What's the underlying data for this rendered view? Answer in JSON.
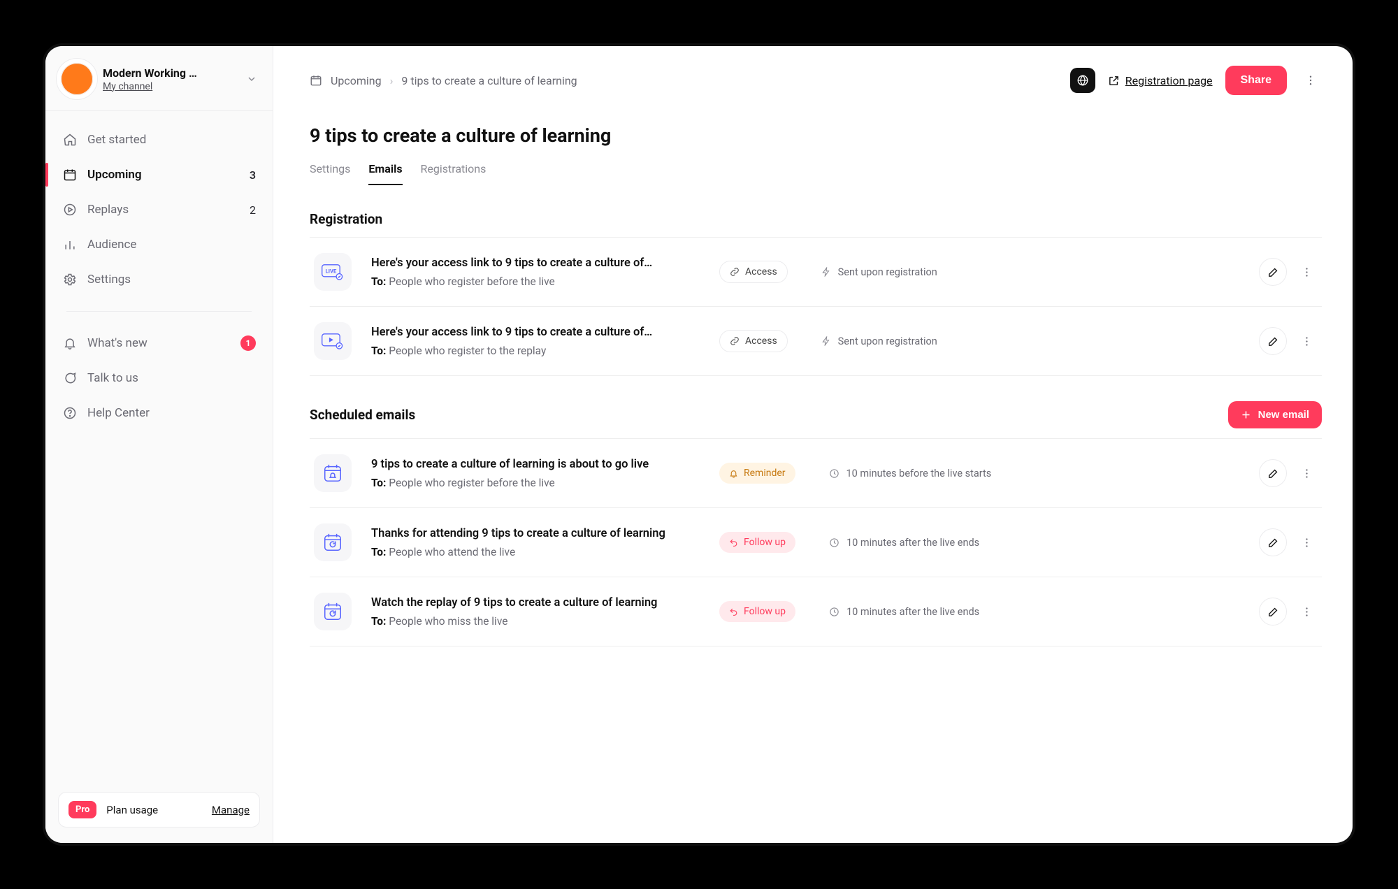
{
  "workspace": {
    "name": "Modern Working …",
    "sublabel": "My channel"
  },
  "nav": {
    "get_started": "Get started",
    "upcoming": "Upcoming",
    "upcoming_count": "3",
    "replays": "Replays",
    "replays_count": "2",
    "audience": "Audience",
    "settings": "Settings",
    "whats_new": "What's new",
    "whats_new_badge": "1",
    "talk": "Talk to us",
    "help": "Help Center"
  },
  "plan": {
    "chip": "Pro",
    "usage": "Plan usage",
    "manage": "Manage"
  },
  "breadcrumb": {
    "root": "Upcoming",
    "leaf": "9 tips to create a culture of learning"
  },
  "header": {
    "reg_link": "Registration page",
    "share": "Share"
  },
  "page": {
    "title": "9 tips to create a culture of learning"
  },
  "tabs": {
    "settings": "Settings",
    "emails": "Emails",
    "registrations": "Registrations"
  },
  "sections": {
    "registration": "Registration",
    "scheduled": "Scheduled emails",
    "new_email": "New email"
  },
  "labels": {
    "to": "To:",
    "access": "Access",
    "reminder": "Reminder",
    "followup": "Follow up",
    "sent_upon": "Sent upon registration"
  },
  "registration_rows": [
    {
      "title": "Here's your access link to 9 tips to create a culture of…",
      "to": "People who register before the live",
      "pill": "access",
      "meta_icon": "bolt",
      "meta": "Sent upon registration"
    },
    {
      "title": "Here's your access link to 9 tips to create a culture of…",
      "to": "People who register to the replay",
      "pill": "access",
      "meta_icon": "bolt",
      "meta": "Sent upon registration"
    }
  ],
  "scheduled_rows": [
    {
      "title": "9 tips to create a culture of learning is about to go live",
      "to": "People who register before the live",
      "pill": "reminder",
      "meta_icon": "clock",
      "meta": "10 minutes before the live starts"
    },
    {
      "title": "Thanks for attending 9 tips to create a culture of learning",
      "to": "People who attend the live",
      "pill": "followup",
      "meta_icon": "clock",
      "meta": "10 minutes after the live ends"
    },
    {
      "title": "Watch the replay of 9 tips to create a culture of learning",
      "to": "People who miss the live",
      "pill": "followup",
      "meta_icon": "clock",
      "meta": "10 minutes after the live ends"
    }
  ]
}
